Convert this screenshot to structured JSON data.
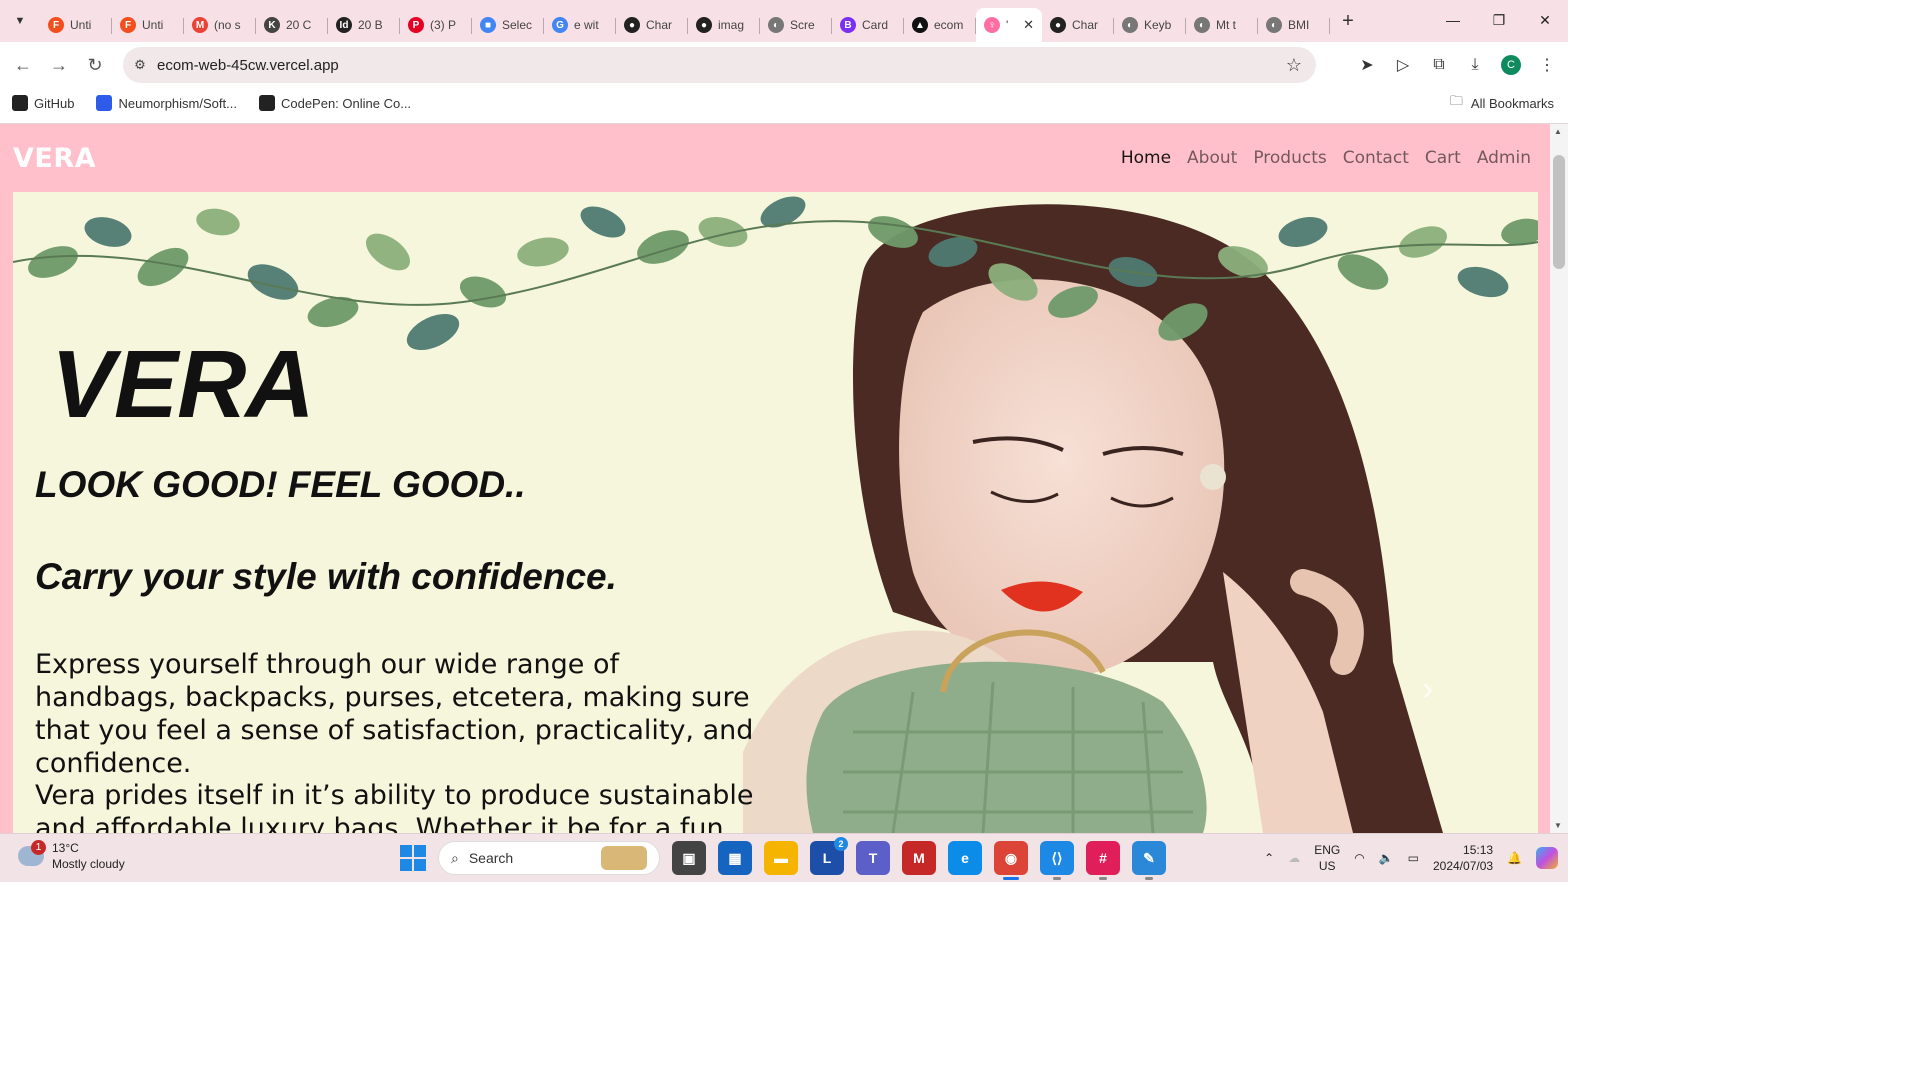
{
  "browser": {
    "tabs": [
      {
        "title": "Unti",
        "fav_color": "#f24e1e",
        "fav_char": "F"
      },
      {
        "title": "Unti",
        "fav_color": "#f24e1e",
        "fav_char": "F"
      },
      {
        "title": "(no s",
        "fav_color": "#ea4335",
        "fav_char": "M"
      },
      {
        "title": "20 C",
        "fav_color": "#444444",
        "fav_char": "K"
      },
      {
        "title": "20 B",
        "fav_color": "#222222",
        "fav_char": "Id"
      },
      {
        "title": "(3) P",
        "fav_color": "#e60023",
        "fav_char": "P"
      },
      {
        "title": "Selec",
        "fav_color": "#4285f4",
        "fav_char": "■"
      },
      {
        "title": "e wit",
        "fav_color": "#4285f4",
        "fav_char": "G"
      },
      {
        "title": "Char",
        "fav_color": "#222222",
        "fav_char": "●"
      },
      {
        "title": "imag",
        "fav_color": "#222222",
        "fav_char": "●"
      },
      {
        "title": "Scre",
        "fav_color": "#777777",
        "fav_char": "◐"
      },
      {
        "title": "Card",
        "fav_color": "#7b2ff7",
        "fav_char": "B"
      },
      {
        "title": "ecom",
        "fav_color": "#111111",
        "fav_char": "▲"
      },
      {
        "title": "'",
        "fav_color": "#ff6fa3",
        "fav_char": "♀",
        "active": true
      },
      {
        "title": "Char",
        "fav_color": "#222222",
        "fav_char": "●"
      },
      {
        "title": "Keyb",
        "fav_color": "#777777",
        "fav_char": "◐"
      },
      {
        "title": "Mt t",
        "fav_color": "#777777",
        "fav_char": "◐"
      },
      {
        "title": "BMI",
        "fav_color": "#777777",
        "fav_char": "◐"
      }
    ],
    "url": "ecom-web-45cw.vercel.app",
    "bookmarks": [
      {
        "label": "GitHub",
        "icon": "github-icon",
        "color": "#222222"
      },
      {
        "label": "Neumorphism/Soft...",
        "icon": "bookmark-square-icon",
        "color": "#2f5bea"
      },
      {
        "label": "CodePen: Online Co...",
        "icon": "codepen-icon",
        "color": "#222222"
      }
    ],
    "all_bookmarks": "All Bookmarks",
    "profile_initial": "C"
  },
  "site": {
    "brand": "VERA",
    "nav": [
      {
        "label": "Home",
        "active": true
      },
      {
        "label": "About",
        "active": false
      },
      {
        "label": "Products",
        "active": false
      },
      {
        "label": "Contact",
        "active": false
      },
      {
        "label": "Cart",
        "active": false
      },
      {
        "label": "Admin",
        "active": false
      }
    ],
    "nav_bg": "#ffc0cb",
    "hero": {
      "title": "VERA",
      "subtitle": "LOOK GOOD! FEEL GOOD..",
      "tagline": "Carry your style with confidence.",
      "paragraph1": "Express yourself through our wide range of handbags, backpacks, purses, etcetera, making sure that you feel a sense of satisfaction, practicality, and confidence.",
      "paragraph2": "Vera prides itself in it’s ability to produce sustainable and affordable luxury bags. Whether it be for a fun",
      "bg": "#f6f6dc"
    }
  },
  "taskbar": {
    "weather_temp": "13°C",
    "weather_desc": "Mostly cloudy",
    "weather_badge": "1",
    "search_placeholder": "Search",
    "apps": [
      {
        "name": "task-view-icon",
        "char": "▣",
        "color": "#444444"
      },
      {
        "name": "store-icon",
        "char": "▦",
        "color": "#1565c0"
      },
      {
        "name": "file-explorer-icon",
        "char": "▬",
        "color": "#f4b400"
      },
      {
        "name": "l-app-icon",
        "char": "L",
        "color": "#1e4fa8",
        "count": "2"
      },
      {
        "name": "teams-icon",
        "char": "T",
        "color": "#5b5fc7"
      },
      {
        "name": "mcafee-icon",
        "char": "M",
        "color": "#c62828"
      },
      {
        "name": "edge-icon",
        "char": "e",
        "color": "#0c8ce9"
      },
      {
        "name": "chrome-icon",
        "char": "◉",
        "color": "#db4437",
        "focused": true
      },
      {
        "name": "vscode-icon",
        "char": "⟨⟩",
        "color": "#1e88e5",
        "running": true
      },
      {
        "name": "slack-icon",
        "char": "#",
        "color": "#e01e5a",
        "running": true
      },
      {
        "name": "snipping-tool-icon",
        "char": "✎",
        "color": "#2b88d8",
        "running": true
      }
    ],
    "lang_top": "ENG",
    "lang_bottom": "US",
    "time": "15:13",
    "date": "2024/07/03"
  }
}
